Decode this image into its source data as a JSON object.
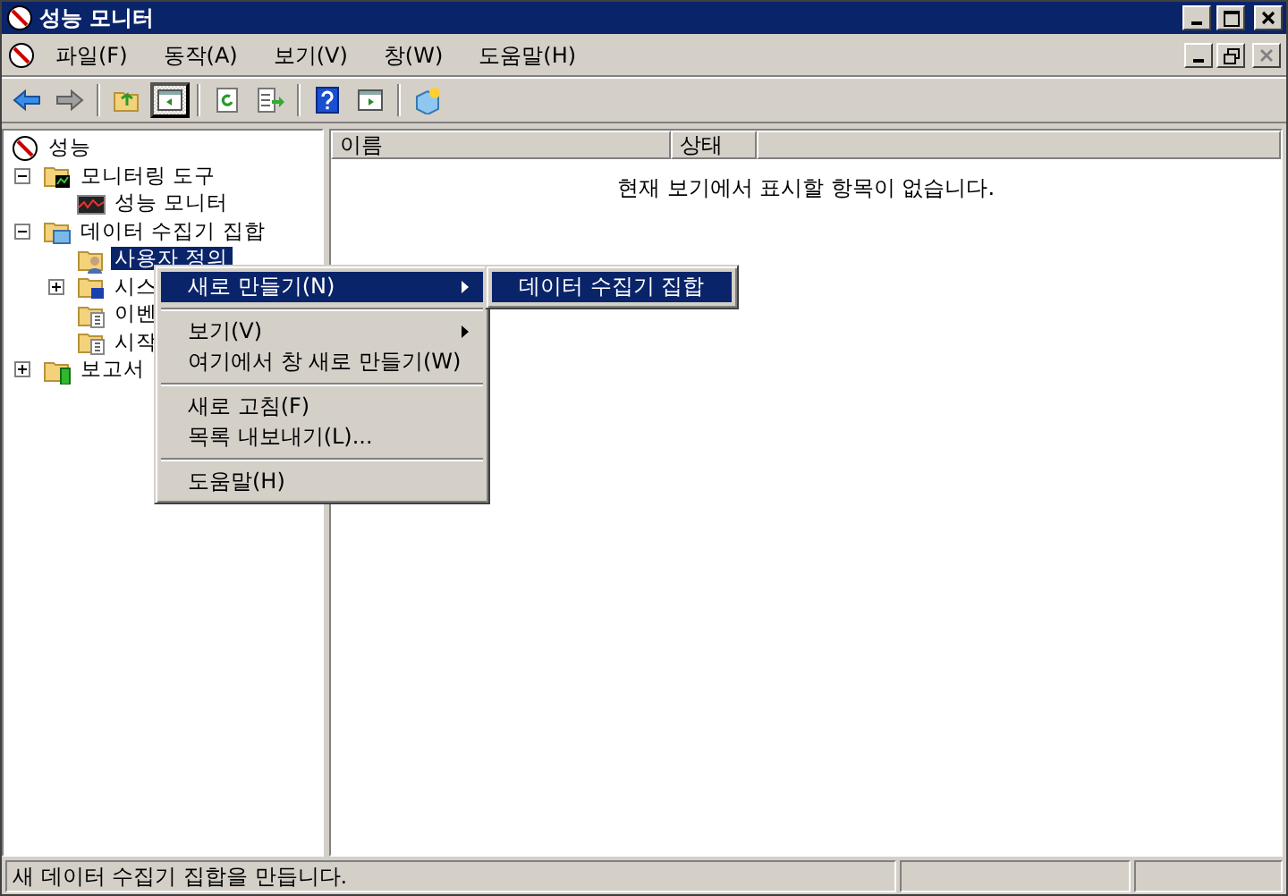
{
  "window": {
    "title": "성능 모니터"
  },
  "menu_bar": [
    {
      "label": "파일(F)"
    },
    {
      "label": "동작(A)"
    },
    {
      "label": "보기(V)"
    },
    {
      "label": "창(W)"
    },
    {
      "label": "도움말(H)"
    }
  ],
  "toolbar": [
    {
      "kind": "back",
      "pressed": false
    },
    {
      "kind": "forward",
      "pressed": false
    },
    {
      "kind": "separator"
    },
    {
      "kind": "up",
      "pressed": false
    },
    {
      "kind": "tree",
      "pressed": true
    },
    {
      "kind": "separator"
    },
    {
      "kind": "refresh",
      "pressed": false
    },
    {
      "kind": "export",
      "pressed": false
    },
    {
      "kind": "separator"
    },
    {
      "kind": "help",
      "pressed": false
    },
    {
      "kind": "pane",
      "pressed": false
    },
    {
      "kind": "separator"
    },
    {
      "kind": "new",
      "pressed": false
    }
  ],
  "tree": [
    {
      "label": "성능",
      "kind": "root",
      "selected": false,
      "children": [
        {
          "label": "모니터링 도구",
          "kind": "tools",
          "expanded": true,
          "selected": false,
          "children": [
            {
              "label": "성능 모니터",
              "kind": "monitor",
              "selected": false
            }
          ]
        },
        {
          "label": "데이터 수집기 집합",
          "kind": "data",
          "expanded": true,
          "selected": false,
          "children": [
            {
              "label": "사용자 정의",
              "kind": "user",
              "selected": true
            },
            {
              "label": "시스",
              "kind": "system",
              "expanded": false,
              "selected": false
            },
            {
              "label": "이벤",
              "kind": "trace",
              "selected": false
            },
            {
              "label": "시작",
              "kind": "trace",
              "selected": false
            }
          ]
        },
        {
          "label": "보고서",
          "kind": "report",
          "expanded": false,
          "selected": false
        }
      ]
    }
  ],
  "list": {
    "columns": [
      "이름",
      "상태"
    ],
    "empty_message": "현재 보기에서 표시할 항목이 없습니다."
  },
  "context_menu": {
    "groups": [
      [
        {
          "label": "새로 만들기(N)",
          "kind": "submenu",
          "selected": true
        }
      ],
      [
        {
          "label": "보기(V)",
          "kind": "submenu",
          "selected": false
        },
        {
          "label": "여기에서 창 새로 만들기(W)",
          "kind": "command",
          "selected": false
        }
      ],
      [
        {
          "label": "새로 고침(F)",
          "kind": "command",
          "selected": false
        },
        {
          "label": "목록 내보내기(L)...",
          "kind": "command",
          "selected": false
        }
      ],
      [
        {
          "label": "도움말(H)",
          "kind": "command",
          "selected": false
        }
      ]
    ]
  },
  "submenu": {
    "items": [
      {
        "label": "데이터 수집기 집합",
        "selected": true
      }
    ]
  },
  "status_bar": {
    "text": "새 데이터 수집기 집합을 만듭니다."
  }
}
